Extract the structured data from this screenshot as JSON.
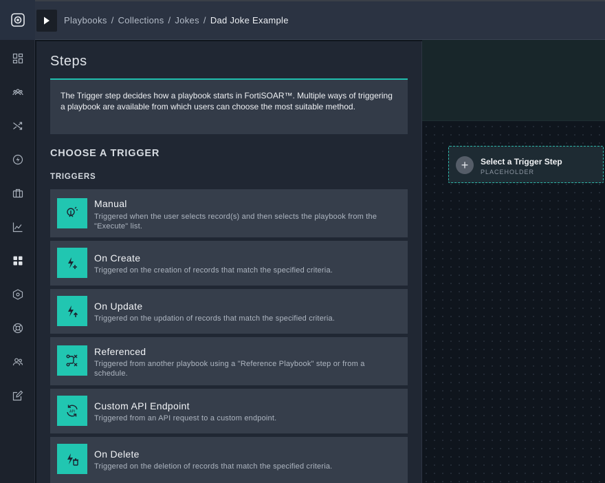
{
  "breadcrumb": {
    "items": [
      "Playbooks",
      "Collections",
      "Jokes"
    ],
    "separator": "/",
    "current": "Dad Joke Example"
  },
  "panel": {
    "title": "Steps",
    "intro": "The Trigger step decides how a playbook starts in FortiSOAR™. Multiple ways of triggering a playbook are available from which users can choose the most suitable method.",
    "choose_heading": "CHOOSE A TRIGGER",
    "triggers_label": "TRIGGERS",
    "triggers": [
      {
        "name": "Manual",
        "description": "Triggered when the user selects record(s) and then selects the playbook from the \"Execute\" list.",
        "icon": "manual-trigger-icon"
      },
      {
        "name": "On Create",
        "description": "Triggered on the creation of records that match the specified criteria.",
        "icon": "on-create-icon"
      },
      {
        "name": "On Update",
        "description": "Triggered on the updation of records that match the specified criteria.",
        "icon": "on-update-icon"
      },
      {
        "name": "Referenced",
        "description": "Triggered from another playbook using a \"Reference Playbook\" step or from a schedule.",
        "icon": "referenced-icon"
      },
      {
        "name": "Custom API Endpoint",
        "description": "Triggered from an API request to a custom endpoint.",
        "icon": "api-endpoint-icon"
      },
      {
        "name": "On Delete",
        "description": "Triggered on the deletion of records that match the specified criteria.",
        "icon": "on-delete-icon"
      }
    ]
  },
  "canvas": {
    "placeholder_title": "Select a Trigger Step",
    "placeholder_sub": "PLACEHOLDER"
  },
  "nav": {
    "icons": [
      "dashboard-icon",
      "users-group-icon",
      "shuffle-icon",
      "bolt-icon",
      "briefcase-icon",
      "line-chart-icon",
      "apps-grid-icon",
      "connector-icon",
      "lifebuoy-icon",
      "team-icon",
      "edit-note-icon"
    ]
  },
  "colors": {
    "accent": "#21c6b1",
    "panel_bg": "#202733",
    "card_bg": "#363e4b"
  }
}
